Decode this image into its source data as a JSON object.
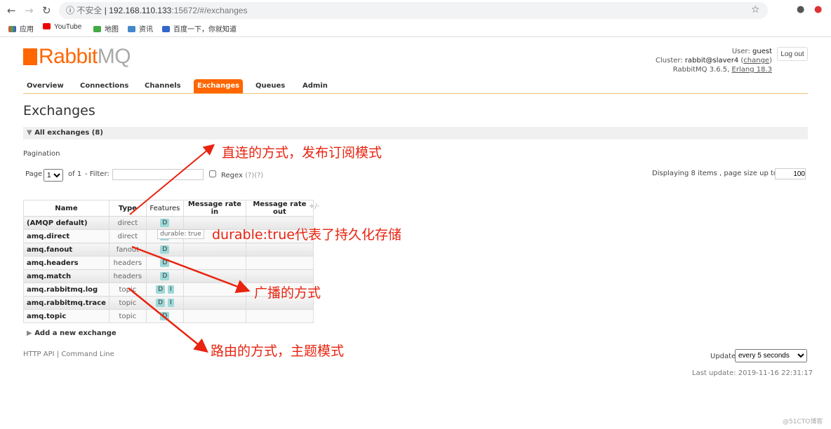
{
  "browser": {
    "security": "不安全",
    "url_host": "192.168.110.133",
    "url_rest": ":15672/#/exchanges",
    "bookmarks": [
      "应用",
      "YouTube",
      "地图",
      "资讯",
      "百度一下，你就知道"
    ]
  },
  "header": {
    "logo": "RabbitMQ",
    "user_label": "User:",
    "user": "guest",
    "cluster_label": "Cluster:",
    "cluster": "rabbit@slaver4",
    "change": "change",
    "version": "RabbitMQ 3.6.5,",
    "erlang": "Erlang 18.3",
    "logout": "Log out"
  },
  "tabs": [
    "Overview",
    "Connections",
    "Channels",
    "Exchanges",
    "Queues",
    "Admin"
  ],
  "active_tab": "Exchanges",
  "page": {
    "title": "Exchanges",
    "section": "All exchanges (8)",
    "pagination": "Pagination",
    "page_label": "Page",
    "page_value": "1",
    "of": "of 1",
    "filter_label": "- Filter:",
    "regex": "Regex",
    "regex_help": "(?)(?)",
    "displaying": "Displaying 8 items , page size up to:",
    "page_size": "100"
  },
  "table": {
    "headers": [
      "Name",
      "Type",
      "Features",
      "Message rate in",
      "Message rate out"
    ],
    "plusminus": "+/-",
    "rows": [
      {
        "name": "(AMQP default)",
        "type": "direct",
        "features": [
          "D"
        ]
      },
      {
        "name": "amq.direct",
        "type": "direct",
        "features": [
          "D"
        ]
      },
      {
        "name": "amq.fanout",
        "type": "fanout",
        "features": [
          "D"
        ]
      },
      {
        "name": "amq.headers",
        "type": "headers",
        "features": [
          "D"
        ]
      },
      {
        "name": "amq.match",
        "type": "headers",
        "features": [
          "D"
        ]
      },
      {
        "name": "amq.rabbitmq.log",
        "type": "topic",
        "features": [
          "D",
          "I"
        ]
      },
      {
        "name": "amq.rabbitmq.trace",
        "type": "topic",
        "features": [
          "D",
          "I"
        ]
      },
      {
        "name": "amq.topic",
        "type": "topic",
        "features": [
          "D"
        ]
      }
    ]
  },
  "tooltip": "durable: true",
  "add_exchange": "Add a new exchange",
  "footer": {
    "http_api": "HTTP API",
    "command_line": "Command Line",
    "update_label": "Update",
    "update_value": "every 5 seconds",
    "last_update": "Last update: 2019-11-16 22:31:17"
  },
  "annotations": [
    "直连的方式，发布订阅模式",
    "durable:true代表了持久化存储",
    "广播的方式",
    "路由的方式，主题模式"
  ],
  "watermark": "@51CTO博客",
  "colors": {
    "accent": "#ff6600",
    "annotation": "#e8230f",
    "feature_badge": "#9ed8d8"
  }
}
